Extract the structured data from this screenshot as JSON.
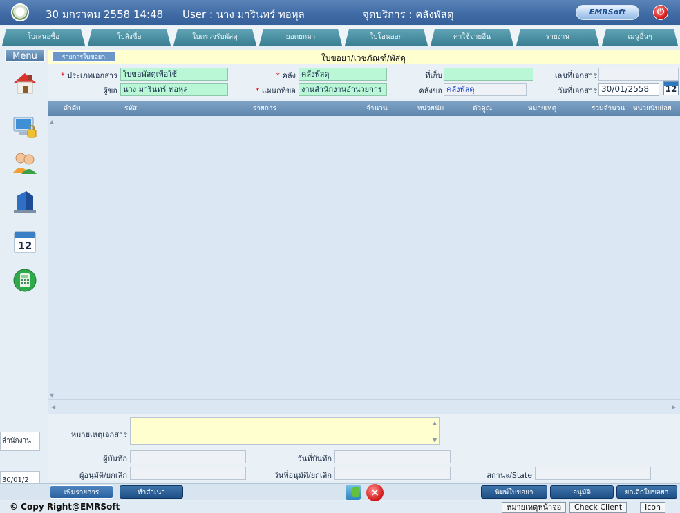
{
  "titlebar": {
    "datetime": "30 มกราคม 2558 14:48",
    "user": "User : นาง มารินทร์ ทอหุล",
    "service_point": "จุดบริการ : คลังพัสดุ",
    "brand": "EMRSoft",
    "power_icon": "power-icon"
  },
  "tabs": [
    "ใบเสนอซื้อ",
    "ใบสั่งซื้อ",
    "ใบตรวจรับพัสดุ",
    "ยอดยกมา",
    "ใบโอนออก",
    "ค่าใช้จ่ายอื่น",
    "รายงาน",
    "เมนูอื่นๆ"
  ],
  "menu_label": "Menu",
  "sidebar_icons": [
    "home-icon",
    "computer-lock-icon",
    "users-icon",
    "building-icon",
    "calendar-icon",
    "calculator-icon"
  ],
  "calendar_day": "12",
  "header": {
    "req_tab": "รายการใบขอยา",
    "title": "ใบขอยา/เวชภัณฑ์/พัสดุ"
  },
  "form": {
    "doc_type_label": "ประเภทเอกสาร",
    "doc_type_value": "ใบขอพัสดุเพื่อใช้",
    "warehouse_label": "คลัง",
    "warehouse_value": "คลังพัสดุ",
    "storage_label": "ที่เก็บ",
    "storage_value": "",
    "doc_no_label": "เลขที่เอกสาร",
    "doc_no_value": "",
    "requester_label": "ผู้ขอ",
    "requester_value": "นาง มารินทร์ ทอหุล",
    "dept_label": "แผนกที่ขอ",
    "dept_value": "งานสำนักงานอำนวยการ",
    "req_wh_label": "คลังขอ",
    "req_wh_value": "คลังพัสดุ",
    "doc_date_label": "วันที่เอกสาร",
    "doc_date_value": "30/01/2558",
    "cal_day": "12"
  },
  "grid": {
    "columns": [
      "ลำดับ",
      "รหัส",
      "รายการ",
      "จำนวน",
      "หน่วยนับ",
      "ตัวคูณ",
      "หมายเหตุ",
      "รวมจำนวน",
      "หน่วยนับย่อย"
    ],
    "rows": []
  },
  "footer": {
    "note_label": "หมายเหตุเอกสาร",
    "note_value": "",
    "recorder_label": "ผู้บันทึก",
    "recorder_value": "",
    "record_date_label": "วันที่บันทึก",
    "record_date_value": "",
    "approver_label": "ผู้อนุมัติ/ยกเลิก",
    "approver_value": "",
    "approve_date_label": "วันที่อนุมัติ/ยกเลิก",
    "approve_date_value": "",
    "state_label": "สถานะ/State",
    "state_value": ""
  },
  "left_boxes": {
    "dept_short": "สำนักงาน",
    "date_short": "30/01/2"
  },
  "toolbar": {
    "add_item": "เพิ่มรายการ",
    "copy": "ทำสำเนา",
    "print": "พิมพ์ใบขอยา",
    "approve": "อนุมัติ",
    "cancel_req": "ยกเลิกใบขอยา"
  },
  "status": {
    "copyright": "© Copy Right@EMRSoft",
    "page_note": "หมายเหตุหน้าจอ",
    "check_client": "Check Client",
    "icon": "Icon"
  }
}
